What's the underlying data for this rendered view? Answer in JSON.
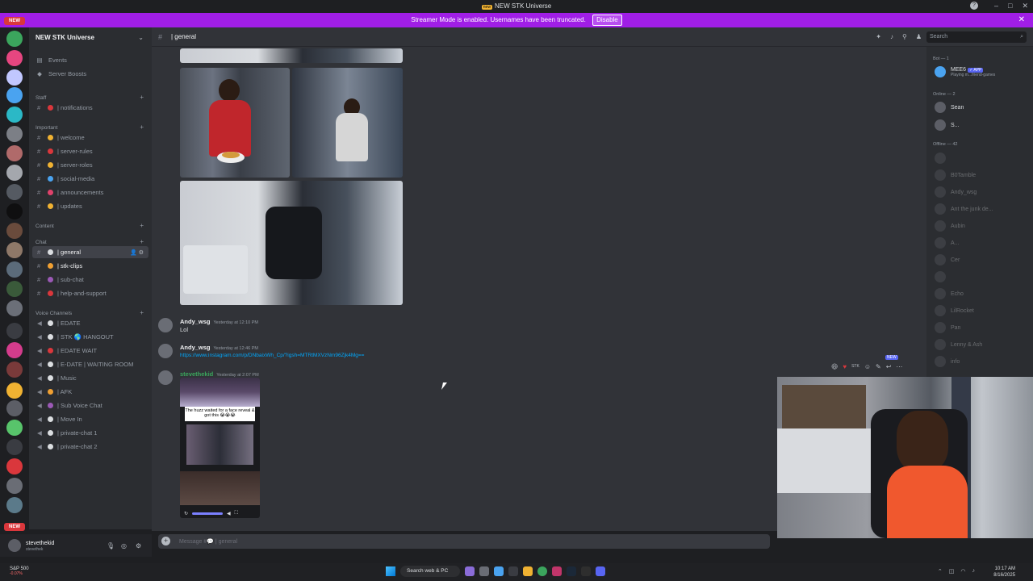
{
  "window": {
    "title": "NEW STK Universe",
    "logo_text": "new",
    "min": "–",
    "max": "□",
    "close": "✕",
    "help": "?"
  },
  "streamer_bar": {
    "message": "Streamer Mode is enabled. Usernames have been truncated.",
    "button": "Disable",
    "close": "✕"
  },
  "guild_rail": {
    "new_badge_top": "NEW",
    "new_badge_bottom": "NEW"
  },
  "server": {
    "name": "NEW STK Universe",
    "events": "Events",
    "boosts": "Server Boosts"
  },
  "categories": [
    {
      "label": "Staff",
      "channels": [
        {
          "name": "| notifications",
          "emoji_color": "#da373c"
        }
      ]
    },
    {
      "label": "Important",
      "channels": [
        {
          "name": "| welcome",
          "emoji_color": "#f0b232"
        },
        {
          "name": "| server-rules",
          "emoji_color": "#da373c"
        },
        {
          "name": "| server-roles",
          "emoji_color": "#f0b232"
        },
        {
          "name": "| social-media",
          "emoji_color": "#4aa3f0"
        },
        {
          "name": "| announcements",
          "emoji_color": "#e0426b"
        },
        {
          "name": "| updates",
          "emoji_color": "#f0b232"
        }
      ]
    },
    {
      "label": "Content",
      "channels": []
    },
    {
      "label": "Chat",
      "channels": [
        {
          "name": "| general",
          "emoji_color": "#dbdee1",
          "active": true
        },
        {
          "name": "| stk-clips",
          "emoji_color": "#f0a032",
          "bold": true
        },
        {
          "name": "| sub-chat",
          "emoji_color": "#9b59b6"
        },
        {
          "name": "| help-and-support",
          "emoji_color": "#da373c"
        }
      ]
    },
    {
      "label": "Voice Channels",
      "channels": [
        {
          "name": "| EDATE",
          "emoji_color": "#dbdee1"
        },
        {
          "name": "| STK 🌎 HANGOUT",
          "emoji_color": "#dbdee1"
        },
        {
          "name": "| EDATE WAIT",
          "emoji_color": "#da373c"
        },
        {
          "name": "| E-DATE | WAITING ROOM",
          "emoji_color": "#dbdee1"
        },
        {
          "name": "| Music",
          "emoji_color": "#dbdee1"
        },
        {
          "name": "| AFK",
          "emoji_color": "#f0a032"
        },
        {
          "name": "| Sub Voice Chat",
          "emoji_color": "#9b59b6"
        },
        {
          "name": "| Move In",
          "emoji_color": "#dbdee1"
        },
        {
          "name": "| private-chat 1",
          "emoji_color": "#dbdee1"
        },
        {
          "name": "| private-chat 2",
          "emoji_color": "#dbdee1"
        }
      ]
    }
  ],
  "user_panel": {
    "name": "stevethekid",
    "status": "stevethek"
  },
  "header": {
    "channel": "| general",
    "search_placeholder": "Search"
  },
  "messages": [
    {
      "author": "Andy_wsg",
      "time": "Yesterday at 12:10 PM",
      "text": "Lol"
    },
    {
      "author": "Andy_wsg",
      "time": "Yesterday at 12:46 PM",
      "link": "https://www.instagram.com/p/DNbaixWh_Cp/?igsh=MTRtMXVzNm96Zjk4Mg=="
    },
    {
      "author": "stevethekid",
      "time": "Yesterday at 2:07 PM",
      "video_caption": "The huzz waited for a face reveal & got this 😭😭😭"
    }
  ],
  "hover_bar": {
    "new_tag": "NEW",
    "stk_label": "STK"
  },
  "composer": {
    "placeholder": "Message #💬 | general"
  },
  "members": {
    "bot_header": "Bot — 1",
    "bot": {
      "name": "MEE6",
      "tag": "✓ APP",
      "activity": "Playing m...friend-games"
    },
    "online_header": "Online — 2",
    "online": [
      "Sean",
      "S..."
    ],
    "offline_header": "Offline — 42",
    "offline": [
      "",
      "B0Tamble",
      "Andy_wsg",
      "Ant the junk de...",
      "Aubin",
      "A...",
      "Cer",
      "",
      "Echo",
      "LilRocket",
      "Pan",
      "Lenny & Ash",
      "info"
    ]
  },
  "taskbar": {
    "stock_name": "S&P 500",
    "stock_change": "-0.07%",
    "search": "Search web & PC",
    "time": "10:17 AM",
    "date": "8/16/2025"
  }
}
